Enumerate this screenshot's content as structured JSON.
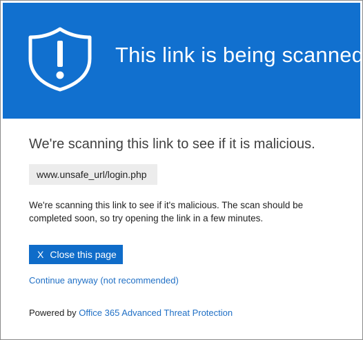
{
  "header": {
    "title": "This link is being scanned.",
    "icon": "shield-exclamation-icon",
    "background_color": "#1170cf"
  },
  "main": {
    "heading": "We're scanning this link to see if it is malicious.",
    "url": "www.unsafe_url/login.php",
    "message": "We're scanning this link to see if it's malicious. The scan should be completed soon, so try opening the link in a few minutes.",
    "close_button": {
      "icon_text": "X",
      "label": "Close this page"
    },
    "continue_link": "Continue anyway (not recommended)"
  },
  "footer": {
    "powered_prefix": "Powered by",
    "powered_link": "Office 365 Advanced Threat Protection"
  },
  "colors": {
    "accent": "#0f6cc9",
    "link": "#1f6fc5"
  }
}
